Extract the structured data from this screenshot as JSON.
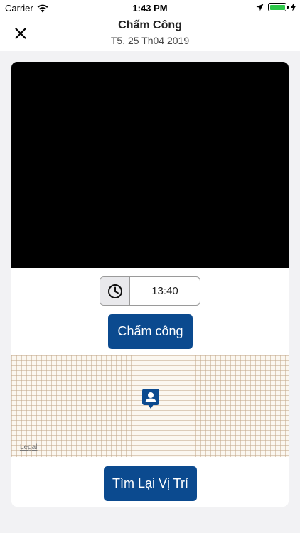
{
  "status_bar": {
    "carrier": "Carrier",
    "time": "1:43 PM",
    "battery_level": 1.0,
    "battery_color": "#2ec84a"
  },
  "header": {
    "title": "Chấm Công",
    "subtitle": "T5, 25 Th04 2019",
    "close_icon": "close-icon"
  },
  "time_field": {
    "icon": "clock-icon",
    "value": "13:40"
  },
  "buttons": {
    "checkin_label": "Chấm công",
    "relocate_label": "Tìm Lại Vị Trí"
  },
  "map": {
    "legal_label": "Legal",
    "pin_icon": "user-location-pin-icon"
  },
  "colors": {
    "accent": "#0b4a8f",
    "camera_bg": "#000000",
    "page_bg": "#f2f2f4"
  }
}
